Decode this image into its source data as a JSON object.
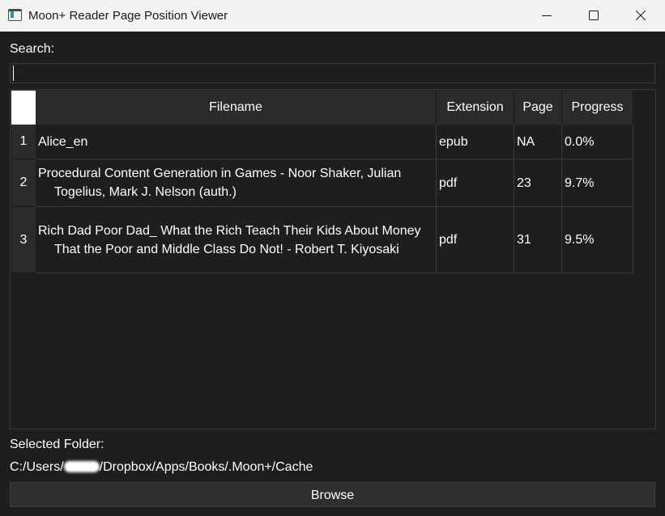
{
  "window": {
    "title": "Moon+ Reader Page Position Viewer",
    "controls": [
      "minimize",
      "maximize",
      "close"
    ]
  },
  "search": {
    "label": "Search:",
    "value": "",
    "placeholder": ""
  },
  "table": {
    "columns": [
      "Filename",
      "Extension",
      "Page",
      "Progress"
    ],
    "rows": [
      {
        "index": "1",
        "filename": "Alice_en",
        "extension": "epub",
        "page": "NA",
        "progress": "0.0%"
      },
      {
        "index": "2",
        "filename": "Procedural Content Generation in Games - Noor Shaker, Julian Togelius, Mark J. Nelson (auth.)",
        "extension": "pdf",
        "page": "23",
        "progress": "9.7%"
      },
      {
        "index": "3",
        "filename": "Rich Dad Poor Dad_ What the Rich Teach Their Kids About Money That the Poor and Middle Class Do Not! - Robert T. Kiyosaki",
        "extension": "pdf",
        "page": "31",
        "progress": "9.5%"
      }
    ]
  },
  "folder": {
    "label": "Selected Folder:",
    "path_prefix": "C:/Users/",
    "path_suffix": "/Dropbox/Apps/Books/.Moon+/Cache"
  },
  "browse": {
    "label": "Browse"
  },
  "icons": {
    "app": "window-app-icon",
    "minimize": "minimize-icon",
    "maximize": "maximize-icon",
    "close": "close-icon"
  },
  "colors": {
    "background": "#1e1e1e",
    "titlebar": "#f3f3f3",
    "header": "#2b2b2b",
    "grid": "#3a3a3a",
    "button": "#2f2f2f",
    "text": "#ffffff"
  }
}
